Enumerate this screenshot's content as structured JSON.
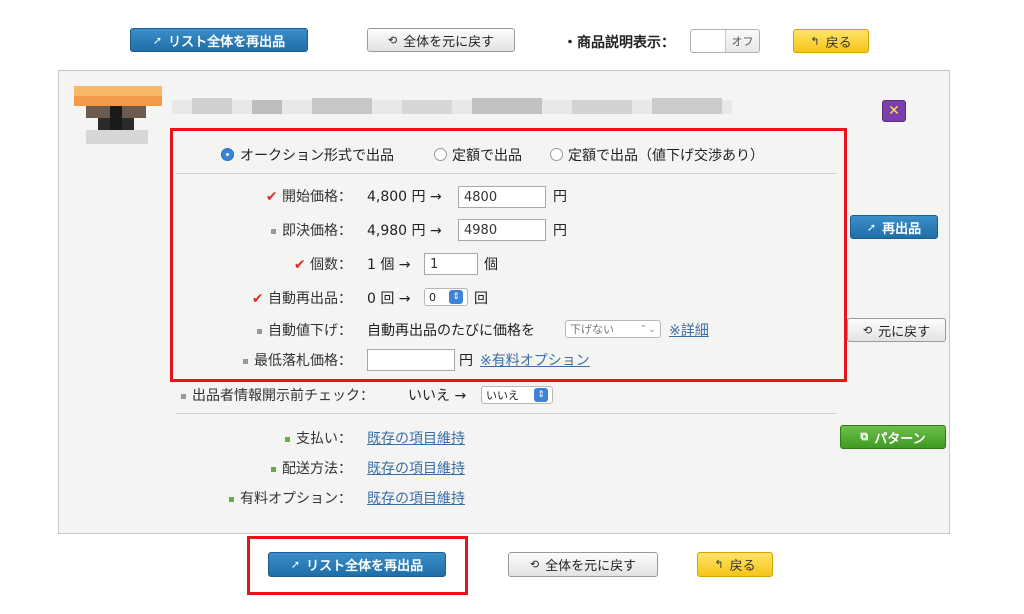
{
  "top_bar": {
    "relist_all_label": "リスト全体を再出品",
    "reset_all_label": "全体を元に戻す",
    "desc_display_label": "・商品説明表示：",
    "desc_toggle_value": "オフ",
    "back_label": "戻る"
  },
  "item": {
    "close_label": "✕"
  },
  "listing_format": {
    "options": [
      {
        "label": "オークション形式で出品",
        "selected": true
      },
      {
        "label": "定額で出品",
        "selected": false
      },
      {
        "label": "定額で出品（値下げ交渉あり）",
        "selected": false
      }
    ]
  },
  "fields": {
    "start_price": {
      "label": "開始価格：",
      "current": "4,800 円 →",
      "value": "4800",
      "unit": "円"
    },
    "buyout_price": {
      "label": "即決価格：",
      "current": "4,980 円 →",
      "value": "4980",
      "unit": "円"
    },
    "quantity": {
      "label": "個数：",
      "current": "1 個 →",
      "value": "1",
      "unit": "個"
    },
    "auto_relist": {
      "label": "自動再出品：",
      "current": "0 回 →",
      "value": "0",
      "unit": "回"
    },
    "auto_price_drop": {
      "label": "自動値下げ：",
      "text": "自動再出品のたびに価格を",
      "select_value": "下げない",
      "link": "※詳細"
    },
    "min_bid": {
      "label": "最低落札価格：",
      "value": "",
      "unit": "円",
      "link": "※有料オプション"
    },
    "seller_check": {
      "label": "出品者情報開示前チェック：",
      "current": "いいえ →",
      "select_value": "いいえ"
    }
  },
  "other_fields": {
    "payment": {
      "label": "支払い：",
      "link": "既存の項目維持"
    },
    "shipping": {
      "label": "配送方法：",
      "link": "既存の項目維持"
    },
    "paid_option": {
      "label": "有料オプション：",
      "link": "既存の項目維持"
    }
  },
  "side_buttons": {
    "relist_label": "再出品",
    "reset_label": "元に戻す",
    "pattern_label": "パターン"
  },
  "bottom_bar": {
    "relist_all_label": "リスト全体を再出品",
    "reset_all_label": "全体を元に戻す",
    "back_label": "戻る"
  },
  "colors": {
    "accent_blue": "#1f6ea8",
    "highlight_red": "#e8141b",
    "back_yellow": "#f5c518",
    "pattern_green": "#3f9a24",
    "link": "#3a6ea5"
  }
}
